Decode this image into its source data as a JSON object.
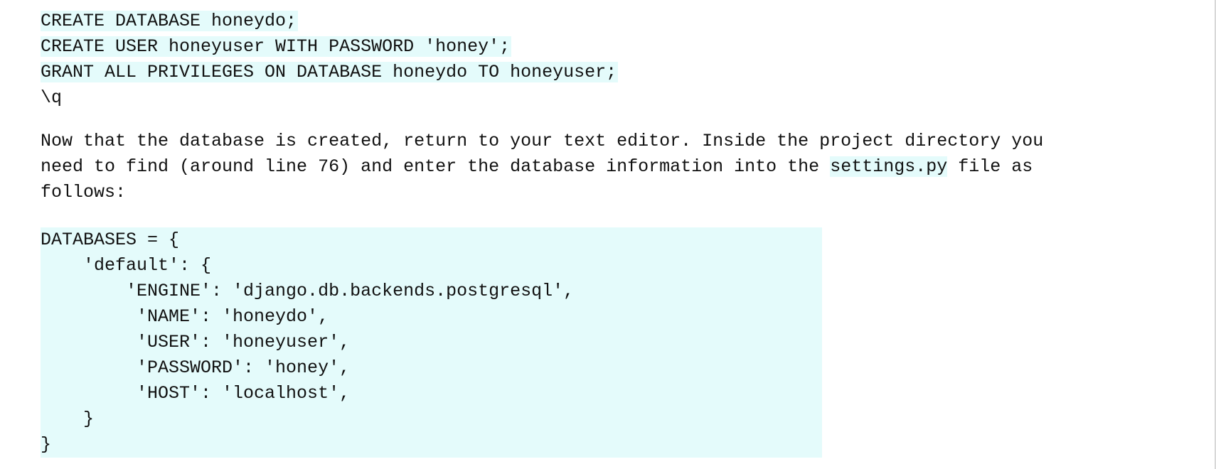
{
  "sql_lines": [
    "CREATE DATABASE honeydo;",
    "CREATE USER honeyuser WITH PASSWORD 'honey';",
    "GRANT ALL PRIVILEGES ON DATABASE honeydo TO honeyuser;",
    "\\q"
  ],
  "paragraph": {
    "line1": "Now that the database is created, return to your text editor. Inside the project directory you",
    "line2_before": "need to find (around line 76) and enter the database information into the ",
    "inline_code": "settings.py",
    "line2_after": " file as",
    "line3": "follows:"
  },
  "python_lines": [
    "DATABASES = {",
    "    'default': {",
    "        'ENGINE': 'django.db.backends.postgresql',",
    "         'NAME': 'honeydo',",
    "         'USER': 'honeyuser',",
    "         'PASSWORD': 'honey',",
    "         'HOST': 'localhost',",
    "    }",
    "}"
  ]
}
